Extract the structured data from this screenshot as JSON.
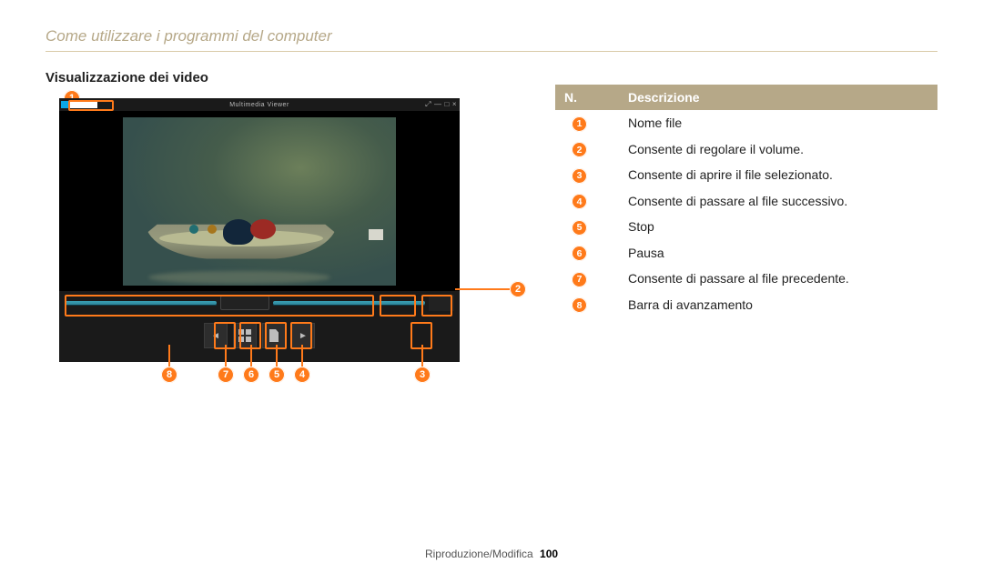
{
  "chapter_title": "Come utilizzare i programmi del computer",
  "section_heading": "Visualizzazione dei video",
  "viewer_title": "Multimedia Viewer",
  "table": {
    "header_n": "N.",
    "header_desc": "Descrizione",
    "rows": [
      {
        "n": "1",
        "desc": "Nome file"
      },
      {
        "n": "2",
        "desc": "Consente di regolare il volume."
      },
      {
        "n": "3",
        "desc": "Consente di aprire il file selezionato."
      },
      {
        "n": "4",
        "desc": "Consente di passare al file successivo."
      },
      {
        "n": "5",
        "desc": "Stop"
      },
      {
        "n": "6",
        "desc": "Pausa"
      },
      {
        "n": "7",
        "desc": "Consente di passare al file precedente."
      },
      {
        "n": "8",
        "desc": "Barra di avanzamento"
      }
    ]
  },
  "callouts": {
    "c1": "1",
    "c2": "2",
    "c3": "3",
    "c4": "4",
    "c5": "5",
    "c6": "6",
    "c7": "7",
    "c8": "8"
  },
  "footer_section": "Riproduzione/Modifica",
  "footer_page": "100"
}
